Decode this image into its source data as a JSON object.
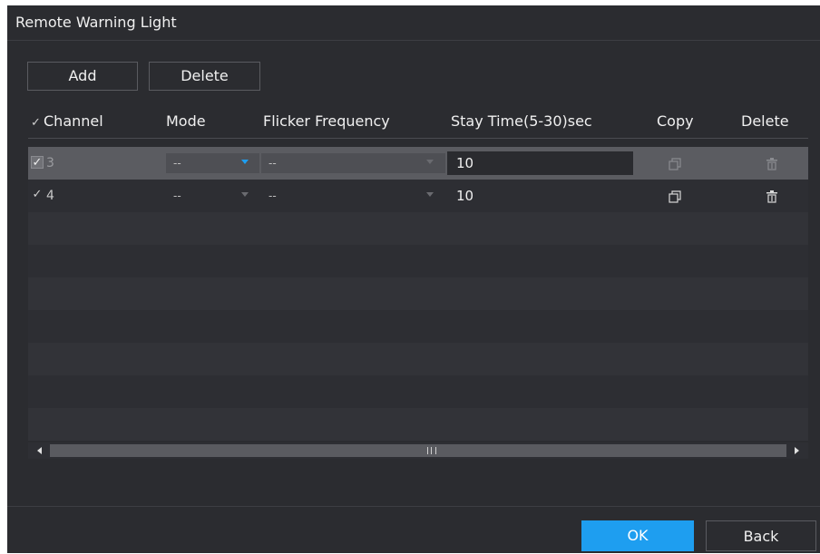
{
  "dialog": {
    "title": "Remote Warning Light"
  },
  "toolbar": {
    "add_label": "Add",
    "delete_label": "Delete"
  },
  "table": {
    "columns": {
      "channel": "Channel",
      "mode": "Mode",
      "flicker_frequency": "Flicker Frequency",
      "stay_time": "Stay Time(5-30)sec",
      "copy": "Copy",
      "delete": "Delete"
    },
    "header_check": "✓",
    "rows": [
      {
        "checked": "✓",
        "channel": "3",
        "mode": "--",
        "flicker_frequency": "--",
        "stay_time": "10",
        "selected": true
      },
      {
        "checked": "✓",
        "channel": "4",
        "mode": "--",
        "flicker_frequency": "--",
        "stay_time": "10",
        "selected": false
      }
    ]
  },
  "footer": {
    "ok_label": "OK",
    "back_label": "Back"
  },
  "colors": {
    "background": "#2b2c30",
    "selected_row": "#5b5c61",
    "accent": "#1e9ef0"
  },
  "icons": {
    "copy": "copy-icon",
    "delete": "trash-icon",
    "dropdown": "caret-down-icon",
    "scroll_left": "scroll-left-arrow-icon",
    "scroll_right": "scroll-right-arrow-icon"
  }
}
